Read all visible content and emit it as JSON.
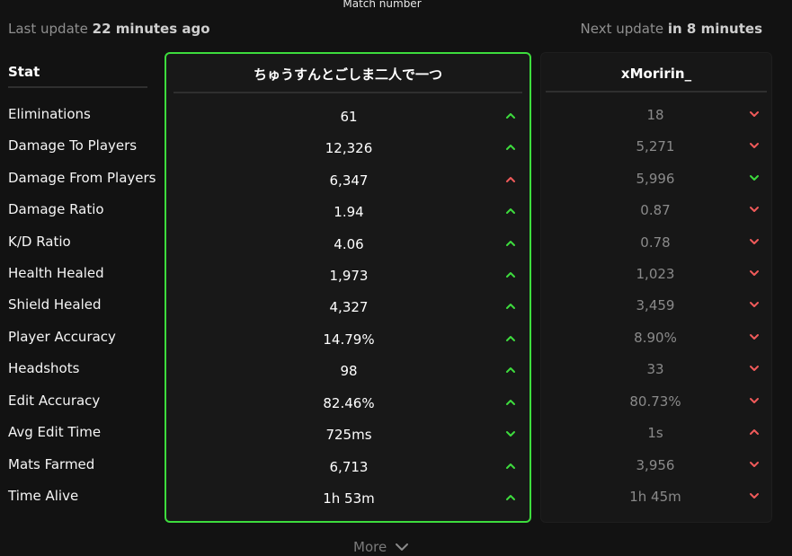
{
  "header": {
    "match_number_label": "Match number",
    "last_update_prefix": "Last update",
    "last_update_value": "22 minutes ago",
    "next_update_prefix": "Next update",
    "next_update_value": "in 8 minutes"
  },
  "stats_header": "Stat",
  "players": [
    {
      "name": "ちゅうすんとごしま二人で一つ",
      "highlighted": true
    },
    {
      "name": "xMoririn_",
      "highlighted": false
    }
  ],
  "rows": [
    {
      "stat": "Eliminations",
      "p1": "61",
      "p1_trend": "up-green",
      "p2": "18",
      "p2_trend": "down-red"
    },
    {
      "stat": "Damage To Players",
      "p1": "12,326",
      "p1_trend": "up-green",
      "p2": "5,271",
      "p2_trend": "down-red"
    },
    {
      "stat": "Damage From Players",
      "p1": "6,347",
      "p1_trend": "up-red",
      "p2": "5,996",
      "p2_trend": "down-green"
    },
    {
      "stat": "Damage Ratio",
      "p1": "1.94",
      "p1_trend": "up-green",
      "p2": "0.87",
      "p2_trend": "down-red"
    },
    {
      "stat": "K/D Ratio",
      "p1": "4.06",
      "p1_trend": "up-green",
      "p2": "0.78",
      "p2_trend": "down-red"
    },
    {
      "stat": "Health Healed",
      "p1": "1,973",
      "p1_trend": "up-green",
      "p2": "1,023",
      "p2_trend": "down-red"
    },
    {
      "stat": "Shield Healed",
      "p1": "4,327",
      "p1_trend": "up-green",
      "p2": "3,459",
      "p2_trend": "down-red"
    },
    {
      "stat": "Player Accuracy",
      "p1": "14.79%",
      "p1_trend": "up-green",
      "p2": "8.90%",
      "p2_trend": "down-red"
    },
    {
      "stat": "Headshots",
      "p1": "98",
      "p1_trend": "up-green",
      "p2": "33",
      "p2_trend": "down-red"
    },
    {
      "stat": "Edit Accuracy",
      "p1": "82.46%",
      "p1_trend": "up-green",
      "p2": "80.73%",
      "p2_trend": "down-red"
    },
    {
      "stat": "Avg Edit Time",
      "p1": "725ms",
      "p1_trend": "down-green",
      "p2": "1s",
      "p2_trend": "up-red"
    },
    {
      "stat": "Mats Farmed",
      "p1": "6,713",
      "p1_trend": "up-green",
      "p2": "3,956",
      "p2_trend": "down-red"
    },
    {
      "stat": "Time Alive",
      "p1": "1h 53m",
      "p1_trend": "up-green",
      "p2": "1h 45m",
      "p2_trend": "down-red"
    }
  ],
  "more_label": "More",
  "colors": {
    "accent_green": "#3ddc3d",
    "arrow_red": "#f05a5a",
    "panel_border_highlight": "#3ddc3d"
  },
  "icons": {
    "up": "chevron-up-icon",
    "down": "chevron-down-icon",
    "more": "chevron-down-icon"
  }
}
